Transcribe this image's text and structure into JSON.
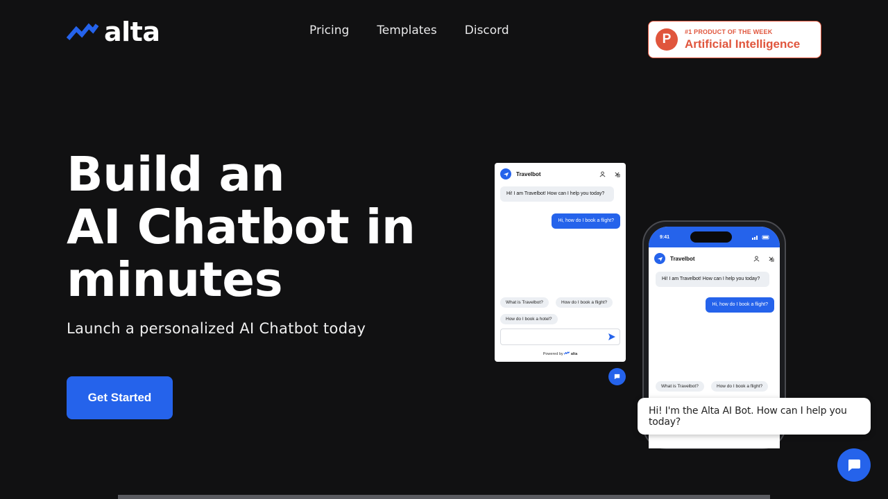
{
  "header": {
    "logo_text": "alta",
    "nav": [
      {
        "label": "Pricing"
      },
      {
        "label": "Templates"
      },
      {
        "label": "Discord"
      }
    ],
    "badge": {
      "letter": "P",
      "top_text": "#1 PRODUCT OF THE WEEK",
      "main_text": "Artificial Intelligence",
      "color": "#e0553c"
    }
  },
  "hero": {
    "title_lines": [
      "Build an",
      "AI Chatbot in",
      "minutes"
    ],
    "subtitle": "Launch a personalized AI Chatbot today",
    "cta_label": "Get Started"
  },
  "widget": {
    "bot_name": "Travelbot",
    "bot_message": "Hi! I am Travelbot! How can I help you today?",
    "user_message": "Hi, how do I book a flight?",
    "suggestions": [
      "What is Travelbot?",
      "How do I book a flight?",
      "How do I book a hotel?"
    ],
    "powered_by": "Powered by",
    "powered_brand": "alta"
  },
  "phone": {
    "time": "9:41",
    "bot_name": "Travelbot",
    "bot_message": "Hi! I am Travelbot! How can I help you today?",
    "user_message": "Hi, how do I book a flight?",
    "suggestions": [
      "What is Travelbot?",
      "How do I book a flight?"
    ]
  },
  "chat_toast": "Hi! I'm the Alta AI Bot. How can I help you today?",
  "colors": {
    "accent": "#2563eb",
    "background": "#111112"
  }
}
